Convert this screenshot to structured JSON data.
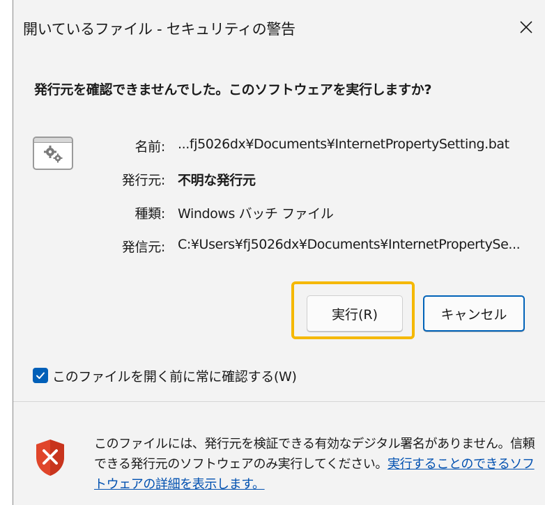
{
  "window": {
    "title": "開いているファイル - セキュリティの警告"
  },
  "question": "発行元を確認できませんでした。このソフトウェアを実行しますか?",
  "icons": {
    "close": "close-icon",
    "file": "batch-file-icon",
    "gear": "gear-icon",
    "shield": "shield-warning-icon",
    "check": "check-icon"
  },
  "details": [
    {
      "label": "名前:",
      "value": "...fj5026dx¥Documents¥InternetPropertySetting.bat"
    },
    {
      "label": "発行元:",
      "value": "不明な発行元"
    },
    {
      "label": "種類:",
      "value": "Windows バッチ ファイル"
    },
    {
      "label": "発信元:",
      "value": "C:¥Users¥fj5026dx¥Documents¥InternetPropertySe..."
    }
  ],
  "buttons": {
    "run": "実行(R)",
    "cancel": "キャンセル"
  },
  "checkbox": {
    "label": "このファイルを開く前に常に確認する(W)",
    "checked": true
  },
  "footer": {
    "text": "このファイルには、発行元を検証できる有効なデジタル署名がありません。信頼できる発行元のソフトウェアのみ実行してください。",
    "link": "実行することのできるソフトウェアの詳細を表示します。"
  },
  "colors": {
    "accent": "#005fb8",
    "highlight": "#f5b800",
    "shield": "#e0452a",
    "link": "#0050b0"
  }
}
